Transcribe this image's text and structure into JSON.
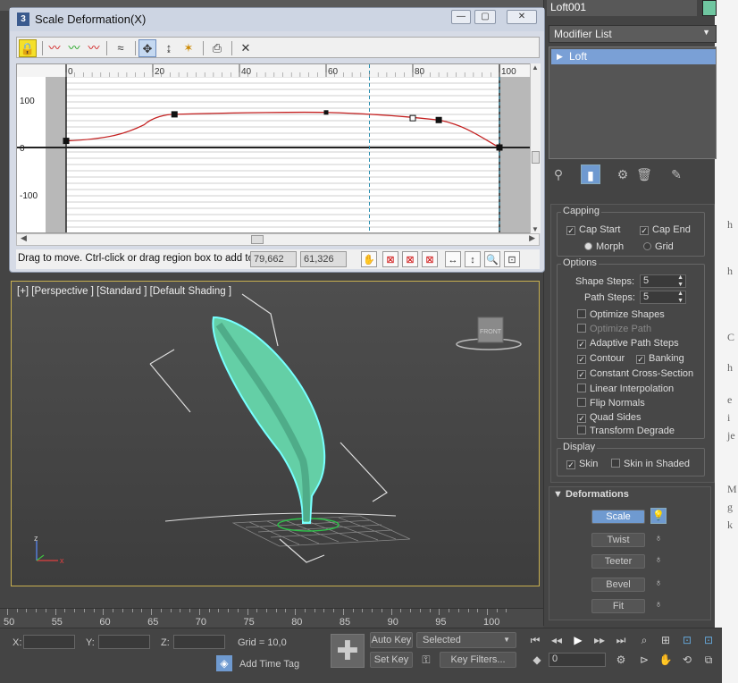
{
  "object_name": "Loft001",
  "object_color": "#6fc6a0",
  "modifier_list": "Modifier List",
  "stack_item": "Loft",
  "surface": {
    "capping_label": "Capping",
    "cap_start": "Cap Start",
    "cap_end": "Cap End",
    "morph": "Morph",
    "grid": "Grid",
    "options_label": "Options",
    "shape_steps_label": "Shape Steps:",
    "shape_steps": "5",
    "path_steps_label": "Path Steps:",
    "path_steps": "5",
    "optimize_shapes": "Optimize Shapes",
    "optimize_path": "Optimize Path",
    "adaptive_path_steps": "Adaptive Path Steps",
    "contour": "Contour",
    "banking": "Banking",
    "constant_cross_section": "Constant Cross-Section",
    "linear_interpolation": "Linear Interpolation",
    "flip_normals": "Flip Normals",
    "quad_sides": "Quad Sides",
    "transform_degrade": "Transform Degrade",
    "display_label": "Display",
    "skin": "Skin",
    "skin_in_shaded": "Skin in Shaded"
  },
  "deformations": {
    "title": "Deformations",
    "buttons": [
      "Scale",
      "Twist",
      "Teeter",
      "Bevel",
      "Fit"
    ]
  },
  "dialog": {
    "title": "Scale Deformation(X)",
    "status": "Drag to move. Ctrl-click or drag region box to add to",
    "value1": "79,662",
    "value2": "61,326",
    "x_ticks": [
      "0",
      "20",
      "40",
      "60",
      "80",
      "100"
    ],
    "y_ticks": [
      "100",
      "0",
      "-100"
    ]
  },
  "viewport": {
    "label": "[+] [Perspective ] [Standard ] [Default Shading ]",
    "viewcube": "FRONT",
    "axis_x": "x",
    "axis_z": "z"
  },
  "timeline_ticks": [
    "50",
    "55",
    "60",
    "65",
    "70",
    "75",
    "80",
    "85",
    "90",
    "95",
    "100"
  ],
  "bottom": {
    "x_label": "X:",
    "y_label": "Y:",
    "z_label": "Z:",
    "grid": "Grid = 10,0",
    "add_time_tag": "Add Time Tag",
    "auto_key": "Auto Key",
    "set_key": "Set Key",
    "selected": "Selected",
    "key_filters": "Key Filters...",
    "frame": "0"
  },
  "background_doc_letters": [
    "h",
    "h",
    "C",
    "h",
    "e",
    "i",
    "je",
    "M",
    "g",
    "k"
  ]
}
